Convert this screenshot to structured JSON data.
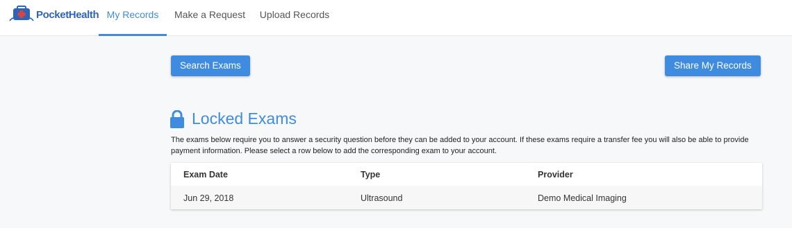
{
  "header": {
    "logo_text": "PocketHealth",
    "logo_icon": "medical-kit-icon",
    "tabs": [
      {
        "label": "My Records",
        "active": true
      },
      {
        "label": "Make a Request",
        "active": false
      },
      {
        "label": "Upload Records",
        "active": false
      }
    ]
  },
  "actions": {
    "search_label": "Search Exams",
    "share_label": "Share My Records"
  },
  "locked": {
    "icon": "lock-icon",
    "title": "Locked Exams",
    "description": "The exams below require you to answer a security question before they can be added to your account. If these exams require a transfer fee you will also be able to provide payment information. Please select a row below to add the corresponding exam to your account."
  },
  "table": {
    "columns": [
      "Exam Date",
      "Type",
      "Provider"
    ],
    "rows": [
      {
        "date": "Jun 29, 2018",
        "type": "Ultrasound",
        "provider": "Demo Medical Imaging"
      }
    ]
  },
  "colors": {
    "accent": "#3f8be0",
    "brand": "#2f63b8",
    "logo_red": "#d64541",
    "background": "#f7f8fa"
  }
}
